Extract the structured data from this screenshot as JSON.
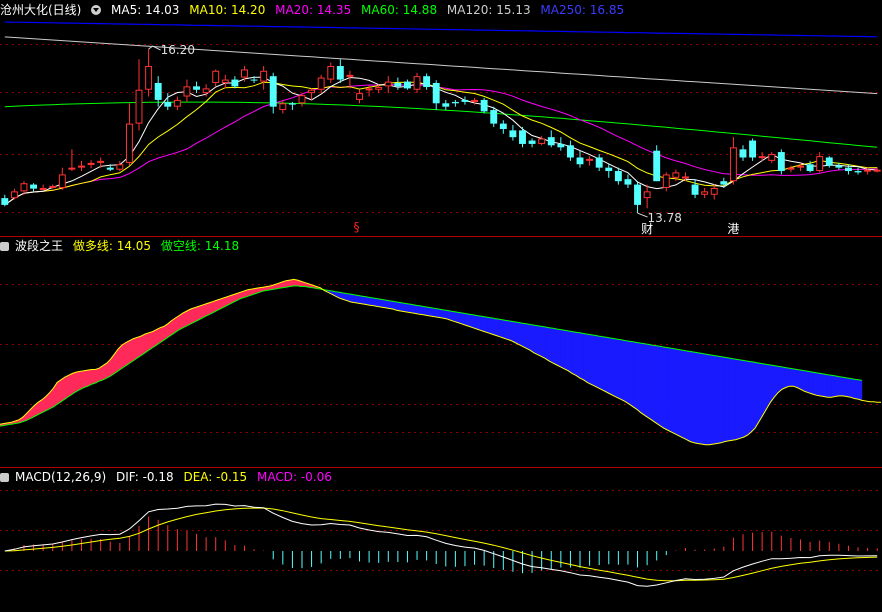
{
  "chart_data": [
    {
      "type": "candlestick",
      "panel": "price",
      "title": "沧州大化(日线)",
      "indicators": [
        {
          "name": "MA5",
          "label": "MA5: 14.03",
          "color": "#ffffff"
        },
        {
          "name": "MA10",
          "label": "MA10: 14.20",
          "color": "#ffff00"
        },
        {
          "name": "MA20",
          "label": "MA20: 14.35",
          "color": "#ff00ff"
        },
        {
          "name": "MA60",
          "label": "MA60: 14.88",
          "color": "#00ff00"
        },
        {
          "name": "MA120",
          "label": "MA120: 15.13",
          "color": "#cccccc"
        },
        {
          "name": "MA250",
          "label": "MA250: 16.85",
          "color": "#0000ff"
        }
      ],
      "ylim": [
        13.5,
        16.6
      ],
      "annotations": [
        {
          "text": "16.20",
          "kind": "high",
          "index": 15,
          "value": 16.2
        },
        {
          "text": "13.78",
          "kind": "low",
          "index": 66,
          "value": 13.78
        }
      ],
      "markers": [
        {
          "text": "§",
          "index": 37,
          "color": "#ff2020"
        },
        {
          "text": "财",
          "index": 67,
          "color": "#ffffff"
        },
        {
          "text": "港",
          "index": 76,
          "color": "#ffffff"
        }
      ],
      "ohlc": [
        [
          14.0,
          14.05,
          13.88,
          13.9
        ],
        [
          14.0,
          14.14,
          13.98,
          14.1
        ],
        [
          14.1,
          14.25,
          14.05,
          14.22
        ],
        [
          14.2,
          14.22,
          14.1,
          14.14
        ],
        [
          14.15,
          14.2,
          14.12,
          14.15
        ],
        [
          14.16,
          14.2,
          14.14,
          14.18
        ],
        [
          14.15,
          14.45,
          14.12,
          14.35
        ],
        [
          14.45,
          14.72,
          14.4,
          14.45
        ],
        [
          14.45,
          14.55,
          14.4,
          14.48
        ],
        [
          14.5,
          14.56,
          14.44,
          14.52
        ],
        [
          14.52,
          14.6,
          14.45,
          14.55
        ],
        [
          14.45,
          14.5,
          14.4,
          14.42
        ],
        [
          14.42,
          14.55,
          14.4,
          14.5
        ],
        [
          14.52,
          15.4,
          14.48,
          15.1
        ],
        [
          15.1,
          16.05,
          15.0,
          15.6
        ],
        [
          15.6,
          16.2,
          15.5,
          15.95
        ],
        [
          15.7,
          15.8,
          15.35,
          15.45
        ],
        [
          15.42,
          15.55,
          15.3,
          15.35
        ],
        [
          15.35,
          15.5,
          15.3,
          15.45
        ],
        [
          15.5,
          15.75,
          15.42,
          15.65
        ],
        [
          15.65,
          15.72,
          15.55,
          15.6
        ],
        [
          15.55,
          15.68,
          15.5,
          15.62
        ],
        [
          15.7,
          15.9,
          15.65,
          15.88
        ],
        [
          15.7,
          15.82,
          15.62,
          15.75
        ],
        [
          15.75,
          15.8,
          15.62,
          15.65
        ],
        [
          15.78,
          15.95,
          15.72,
          15.9
        ],
        [
          15.75,
          15.8,
          15.7,
          15.74
        ],
        [
          15.72,
          15.95,
          15.6,
          15.88
        ],
        [
          15.8,
          15.85,
          15.25,
          15.35
        ],
        [
          15.3,
          15.45,
          15.25,
          15.4
        ],
        [
          15.4,
          15.42,
          15.3,
          15.38
        ],
        [
          15.4,
          15.55,
          15.35,
          15.52
        ],
        [
          15.55,
          15.62,
          15.45,
          15.6
        ],
        [
          15.6,
          15.82,
          15.55,
          15.78
        ],
        [
          15.75,
          16.0,
          15.7,
          15.95
        ],
        [
          15.95,
          16.05,
          15.7,
          15.75
        ],
        [
          15.8,
          15.88,
          15.62,
          15.82
        ],
        [
          15.45,
          15.6,
          15.4,
          15.55
        ],
        [
          15.6,
          15.66,
          15.5,
          15.62
        ],
        [
          15.6,
          15.68,
          15.55,
          15.64
        ],
        [
          15.65,
          15.8,
          15.55,
          15.72
        ],
        [
          15.7,
          15.78,
          15.6,
          15.65
        ],
        [
          15.72,
          15.75,
          15.6,
          15.62
        ],
        [
          15.6,
          15.85,
          15.55,
          15.8
        ],
        [
          15.8,
          15.84,
          15.6,
          15.64
        ],
        [
          15.7,
          15.74,
          15.3,
          15.4
        ],
        [
          15.4,
          15.45,
          15.3,
          15.35
        ],
        [
          15.42,
          15.45,
          15.35,
          15.4
        ],
        [
          15.45,
          15.5,
          15.38,
          15.42
        ],
        [
          15.42,
          15.48,
          15.38,
          15.45
        ],
        [
          15.45,
          15.48,
          15.25,
          15.28
        ],
        [
          15.3,
          15.35,
          15.05,
          15.1
        ],
        [
          15.1,
          15.15,
          14.95,
          15.02
        ],
        [
          15.0,
          15.08,
          14.85,
          14.9
        ],
        [
          15.0,
          15.05,
          14.75,
          14.8
        ],
        [
          14.85,
          14.88,
          14.75,
          14.8
        ],
        [
          14.8,
          14.92,
          14.78,
          14.88
        ],
        [
          14.9,
          15.0,
          14.75,
          14.78
        ],
        [
          14.8,
          14.9,
          14.7,
          14.75
        ],
        [
          14.78,
          14.85,
          14.55,
          14.6
        ],
        [
          14.6,
          14.7,
          14.45,
          14.5
        ],
        [
          14.55,
          14.62,
          14.48,
          14.58
        ],
        [
          14.6,
          14.65,
          14.4,
          14.45
        ],
        [
          14.45,
          14.5,
          14.3,
          14.4
        ],
        [
          14.4,
          14.45,
          14.2,
          14.25
        ],
        [
          14.28,
          14.35,
          14.15,
          14.2
        ],
        [
          14.2,
          14.25,
          13.78,
          13.9
        ],
        [
          14.0,
          14.2,
          13.85,
          14.1
        ],
        [
          14.7,
          14.78,
          14.25,
          14.25
        ],
        [
          14.15,
          14.38,
          14.1,
          14.35
        ],
        [
          14.3,
          14.42,
          14.25,
          14.38
        ],
        [
          14.3,
          14.38,
          14.25,
          14.32
        ],
        [
          14.2,
          14.28,
          14.0,
          14.05
        ],
        [
          14.05,
          14.15,
          14.0,
          14.1
        ],
        [
          14.05,
          14.2,
          13.98,
          14.15
        ],
        [
          14.25,
          14.3,
          14.15,
          14.2
        ],
        [
          14.25,
          14.9,
          14.2,
          14.75
        ],
        [
          14.72,
          14.78,
          14.55,
          14.6
        ],
        [
          14.85,
          14.88,
          14.55,
          14.6
        ],
        [
          14.6,
          14.68,
          14.55,
          14.62
        ],
        [
          14.55,
          14.68,
          14.52,
          14.65
        ],
        [
          14.68,
          14.72,
          14.35,
          14.4
        ],
        [
          14.42,
          14.48,
          14.38,
          14.45
        ],
        [
          14.45,
          14.52,
          14.4,
          14.48
        ],
        [
          14.5,
          14.55,
          14.38,
          14.4
        ],
        [
          14.4,
          14.68,
          14.38,
          14.62
        ],
        [
          14.6,
          14.62,
          14.45,
          14.48
        ],
        [
          14.48,
          14.52,
          14.42,
          14.45
        ],
        [
          14.45,
          14.5,
          14.35,
          14.4
        ],
        [
          14.4,
          14.45,
          14.35,
          14.38
        ],
        [
          14.4,
          14.45,
          14.35,
          14.42
        ],
        [
          14.4,
          14.45,
          14.38,
          14.42
        ]
      ]
    },
    {
      "type": "area",
      "panel": "wave",
      "title": "波段之王",
      "series": [
        {
          "name": "做多线",
          "label": "做多线: 14.05",
          "color": "#ffff00",
          "values": [
            -9,
            -8,
            -7,
            -6,
            -4,
            -2,
            2,
            8,
            14,
            20,
            25,
            29,
            34,
            40,
            47,
            56,
            60,
            64,
            67,
            70,
            72,
            73,
            74,
            75,
            76,
            76,
            78,
            82,
            86,
            92,
            100,
            108,
            114,
            118,
            121,
            124,
            126,
            128,
            131,
            133,
            135,
            138,
            141,
            143,
            147,
            152,
            156,
            160,
            164,
            167,
            170,
            172,
            174,
            176,
            178,
            180,
            182,
            184,
            186,
            188,
            190,
            192,
            194,
            196,
            198,
            200,
            201,
            202,
            203,
            204,
            205,
            206,
            208,
            210,
            212,
            214,
            215,
            216,
            215,
            213,
            211,
            209,
            207,
            205,
            203,
            199,
            196,
            193,
            190,
            187,
            185,
            183,
            181,
            180,
            179,
            178,
            177,
            176,
            175,
            174,
            173,
            172,
            171,
            170,
            168,
            167,
            166,
            165,
            164,
            163,
            162,
            161,
            160,
            159,
            158,
            157,
            156,
            155,
            153,
            151,
            149,
            147,
            145,
            143,
            141,
            139,
            137,
            135,
            133,
            131,
            129,
            127,
            125,
            123,
            121,
            118,
            115,
            112,
            109,
            106,
            102,
            99,
            96,
            93,
            89,
            86,
            83,
            80,
            77,
            74,
            70,
            67,
            63,
            60,
            56,
            53,
            50,
            47,
            44,
            41,
            38,
            35,
            32,
            29,
            26,
            22,
            18,
            14,
            9,
            5,
            1,
            -3,
            -7,
            -11,
            -15,
            -18,
            -21,
            -24,
            -27,
            -30,
            -33,
            -36,
            -38,
            -39,
            -40,
            -41,
            -41,
            -40,
            -39,
            -38,
            -36,
            -35,
            -34,
            -33,
            -31,
            -29,
            -26,
            -21,
            -15,
            -5,
            5,
            15,
            25,
            33,
            40,
            45,
            48,
            50,
            50,
            48,
            45,
            42,
            40,
            38,
            36,
            35,
            34,
            33,
            33,
            34,
            35,
            35,
            34,
            33,
            31,
            30,
            28,
            27,
            26,
            26,
            25,
            25
          ]
        },
        {
          "name": "做空线",
          "label": "做空线: 14.18",
          "color": "#00ff00",
          "values": [
            -12,
            -11,
            -10,
            -9,
            -8,
            -7,
            -5,
            -3,
            0,
            3,
            6,
            9,
            12,
            15,
            18,
            22,
            26,
            30,
            34,
            38,
            42,
            45,
            48,
            50,
            53,
            55,
            58,
            60,
            63,
            66,
            70,
            74,
            78,
            82,
            86,
            90,
            94,
            98,
            102,
            106,
            110,
            114,
            118,
            122,
            126,
            130,
            134,
            138,
            141,
            144,
            147,
            150,
            153,
            156,
            159,
            162,
            165,
            168,
            171,
            174,
            177,
            180,
            183,
            186,
            188,
            190,
            192,
            194,
            196,
            198,
            199,
            200,
            201,
            202,
            203,
            204,
            205,
            206,
            206,
            205,
            205,
            204,
            203,
            202,
            201,
            200,
            199,
            198,
            197,
            196,
            195,
            194,
            193,
            192,
            191,
            190,
            189,
            188,
            187,
            186,
            185,
            184,
            183,
            182,
            181,
            180,
            179,
            178,
            177,
            176,
            175,
            174,
            173,
            172,
            171,
            170,
            169,
            168,
            167,
            166,
            165,
            164,
            163,
            162,
            161,
            160,
            159,
            158,
            157,
            156,
            155,
            154,
            153,
            152,
            151,
            150,
            149,
            148,
            147,
            146,
            145,
            144,
            143,
            142,
            141,
            140,
            139,
            138,
            137,
            136,
            135,
            134,
            133,
            132,
            131,
            130,
            129,
            128,
            127,
            126,
            125,
            124,
            123,
            122,
            121,
            120,
            119,
            118,
            117,
            116,
            115,
            114,
            113,
            112,
            111,
            110,
            109,
            108,
            107,
            106,
            105,
            104,
            103,
            102,
            101,
            100,
            99,
            98,
            97,
            96,
            95,
            94,
            93,
            92,
            91,
            90,
            89,
            88,
            87,
            86,
            85,
            84,
            83,
            82,
            81,
            80,
            79,
            78,
            77,
            76,
            75,
            74,
            73,
            72,
            71,
            70,
            69,
            68,
            67,
            66,
            65,
            64,
            63,
            62,
            61,
            60,
            59
          ]
        }
      ],
      "ylim": [
        -60,
        240
      ]
    },
    {
      "type": "bar",
      "panel": "macd",
      "title": "MACD(12,26,9)",
      "indicators": [
        {
          "name": "DIF",
          "label": "DIF: -0.18",
          "color": "#ffffff"
        },
        {
          "name": "DEA",
          "label": "DEA: -0.15",
          "color": "#ffff00"
        },
        {
          "name": "MACD",
          "label": "MACD: -0.06",
          "color": "#ff00ff"
        }
      ],
      "ylim": [
        -0.55,
        0.55
      ]
    }
  ],
  "colors": {
    "up": "#ff3333",
    "down": "#54ffff",
    "separator": "#b00000",
    "grid": "#8a0000",
    "bull_fill": "#ff2a5a",
    "bear_fill": "#1a1aff"
  }
}
